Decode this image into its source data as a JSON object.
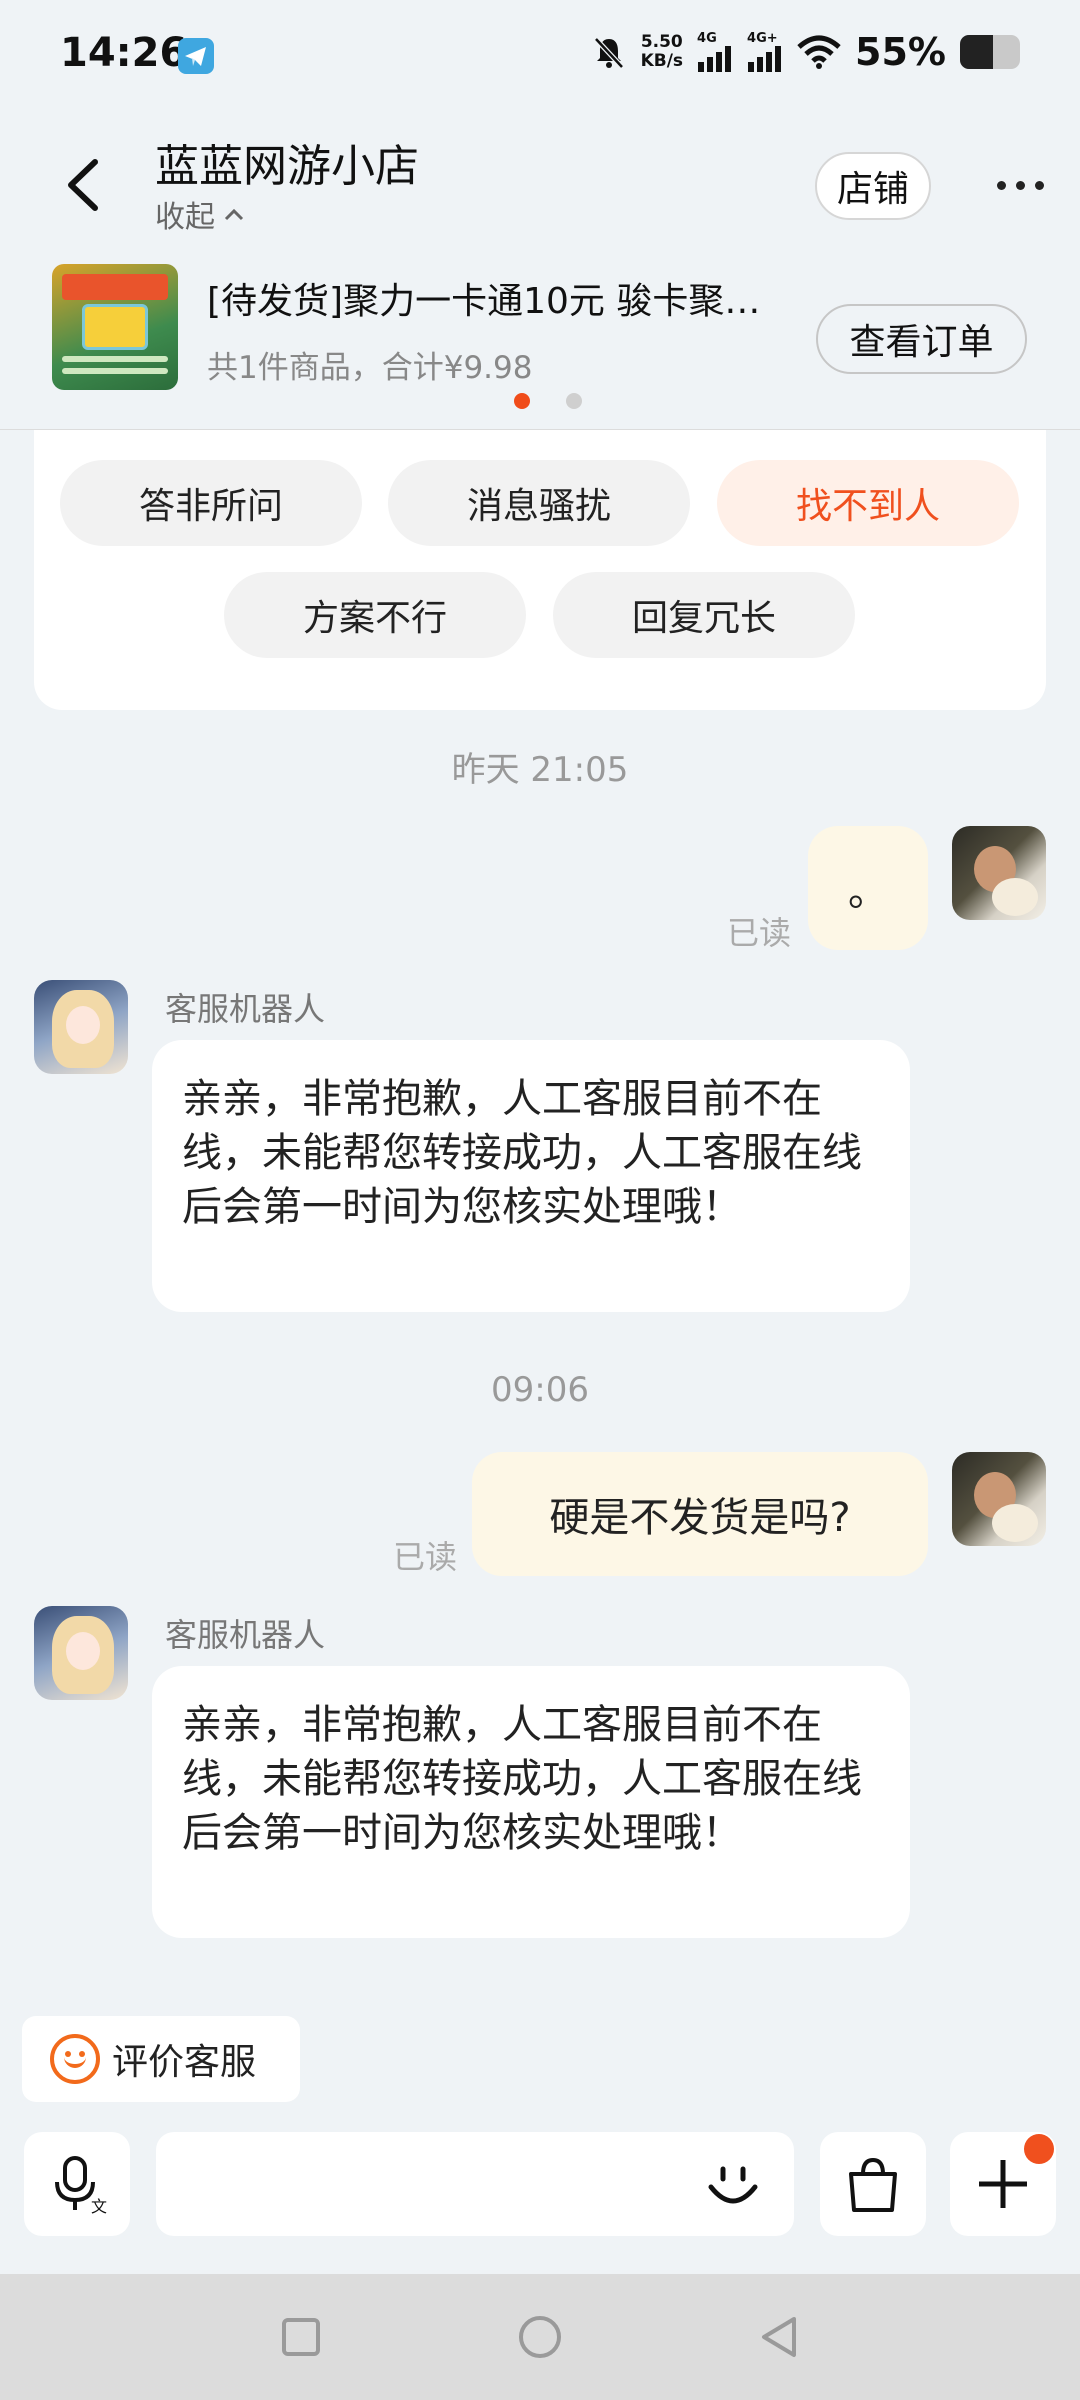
{
  "status_bar": {
    "time": "14:26",
    "net_speed_value": "5.50",
    "net_speed_unit": "KB/s",
    "signal1_label": "4G",
    "signal2_label": "4G+",
    "battery_percent": "55%",
    "battery_level": 0.55,
    "icons": [
      "telegram-icon",
      "mute-bell-icon",
      "signal-icon",
      "wifi-icon",
      "battery-icon"
    ]
  },
  "header": {
    "shop_name": "蓝蓝网游小店",
    "collapse_label": "收起",
    "store_button": "店铺",
    "order": {
      "title": "[待发货]聚力一卡通10元 骏卡聚…",
      "summary": "共1件商品，合计¥9.98",
      "view_button": "查看订单"
    },
    "carousel_pages": 2,
    "carousel_active": 1
  },
  "feedback": {
    "options": [
      "答非所问",
      "消息骚扰",
      "找不到人",
      "方案不行",
      "回复冗长"
    ],
    "selected": "找不到人"
  },
  "chat": {
    "timestamps": [
      "昨天  21:05",
      "09:06"
    ],
    "read_label": "已读",
    "bot_name": "客服机器人",
    "messages": [
      {
        "from": "user",
        "text": "。"
      },
      {
        "from": "bot",
        "text": "亲亲，非常抱歉，人工客服目前不在线，未能帮您转接成功，人工客服在线后会第一时间为您核实处理哦！"
      },
      {
        "from": "user",
        "text": "硬是不发货是吗?"
      },
      {
        "from": "bot",
        "text": "亲亲，非常抱歉，人工客服目前不在线，未能帮您转接成功，人工客服在线后会第一时间为您核实处理哦！"
      }
    ]
  },
  "rate_button": "评价客服",
  "input_bar": {
    "placeholder": "",
    "icons": [
      "voice-input-icon",
      "emoji-icon",
      "shopping-bag-icon",
      "plus-icon"
    ]
  },
  "colors": {
    "accent": "#f0501e",
    "background": "#eff3f6",
    "outgoing_bubble": "#fdf7e6"
  }
}
